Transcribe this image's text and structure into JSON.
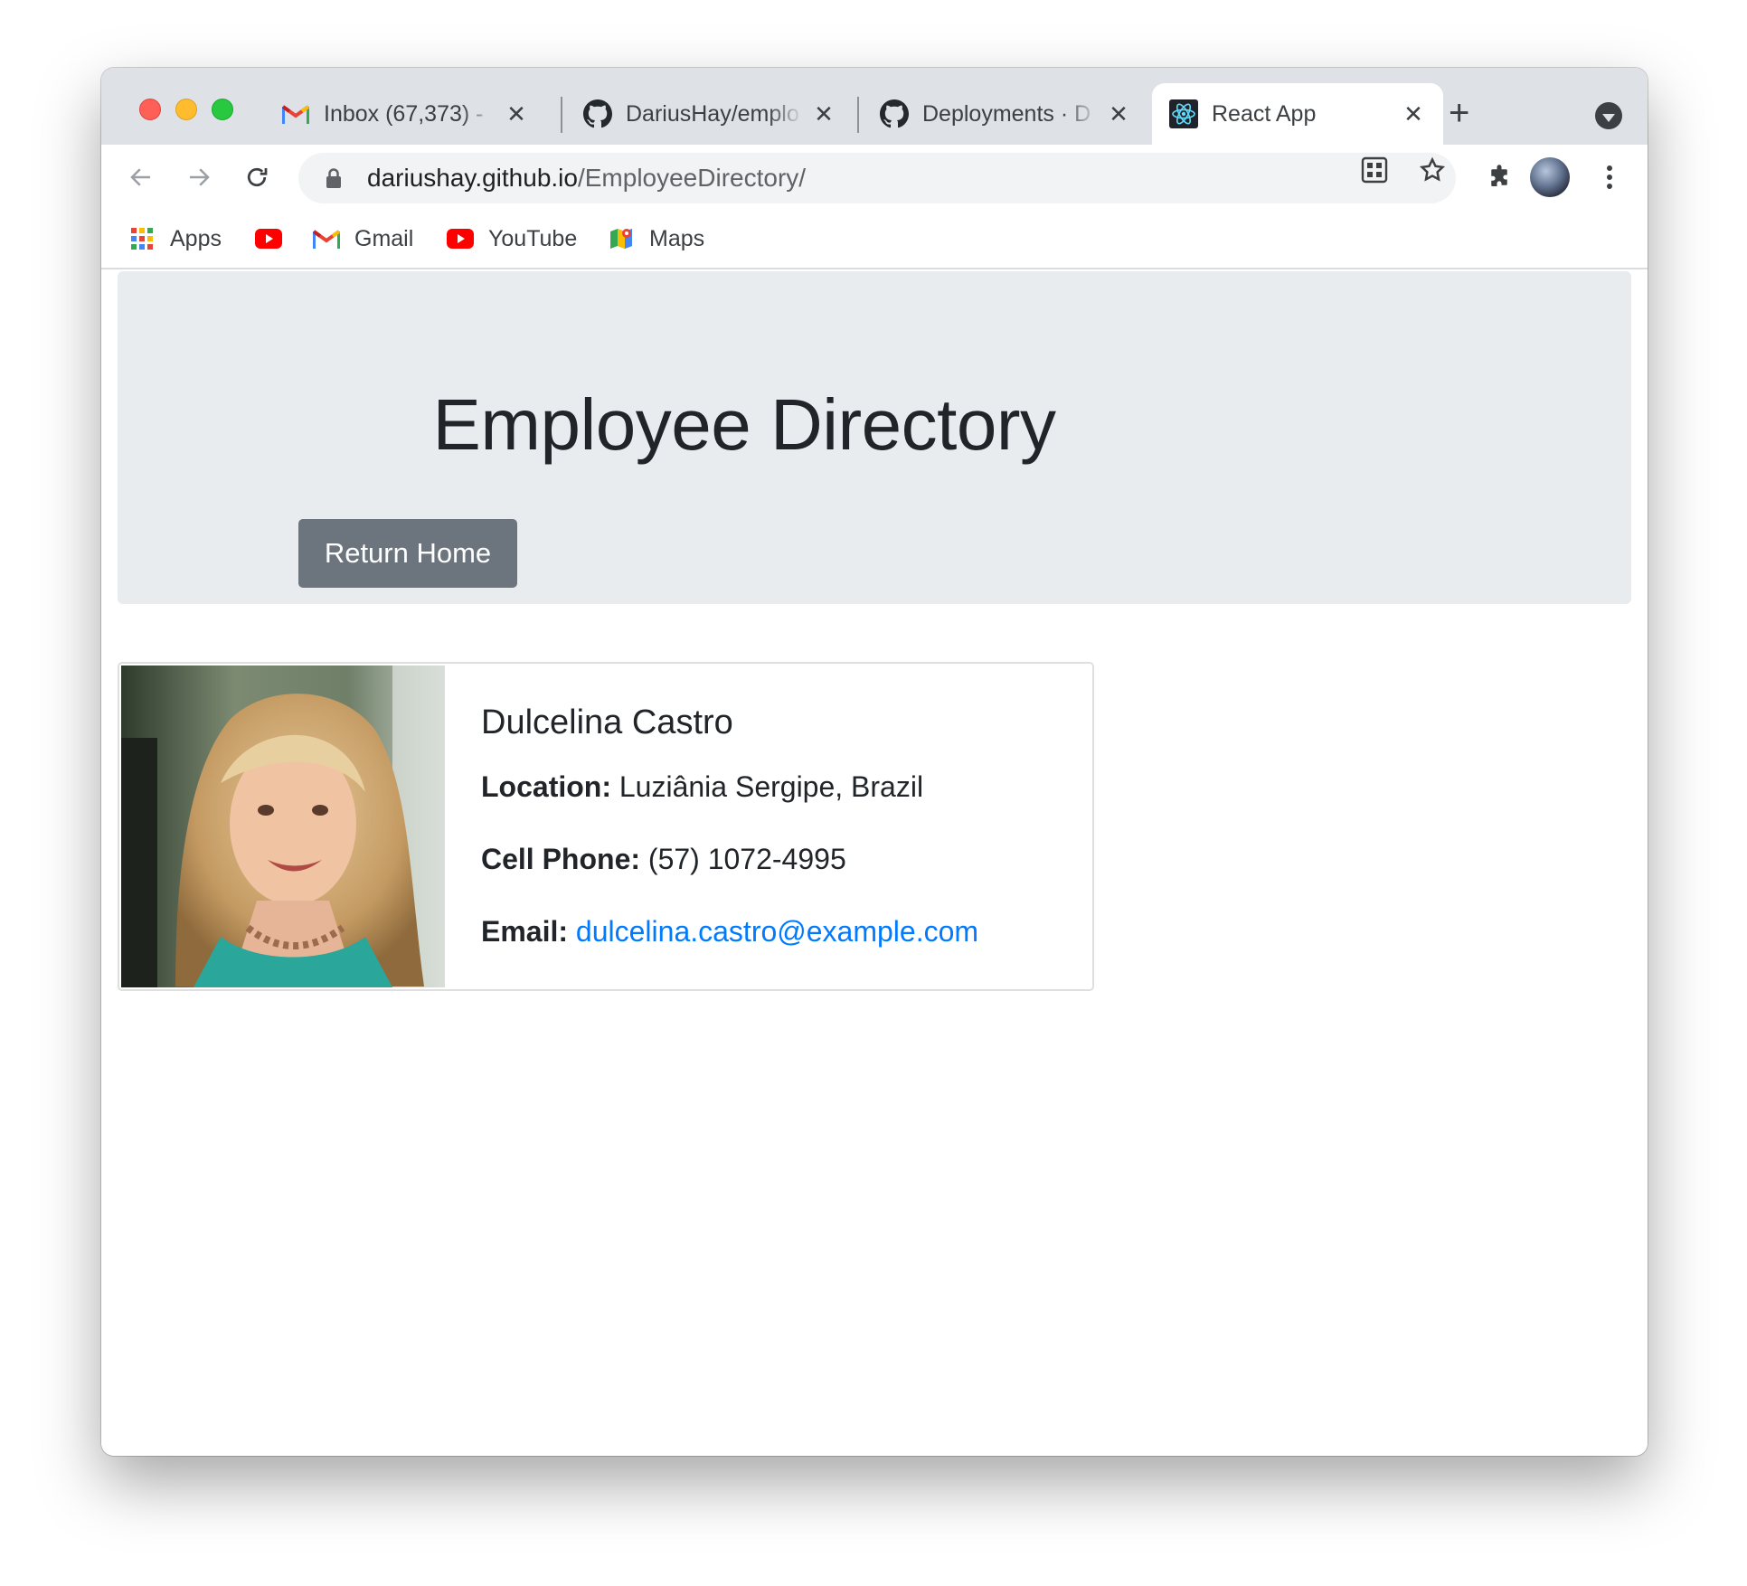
{
  "browser": {
    "tabs": [
      {
        "title": "Inbox (67,373) - ",
        "favicon": "gmail-icon"
      },
      {
        "title": "DariusHay/emplo",
        "favicon": "github-icon"
      },
      {
        "title": "Deployments · D",
        "favicon": "github-icon"
      },
      {
        "title": "React App",
        "favicon": "react-icon",
        "active": true
      }
    ],
    "address": {
      "host": "dariushay.github.io",
      "path": "/EmployeeDirectory/"
    },
    "bookmarks": [
      {
        "label": "Apps",
        "icon": "apps-grid-icon"
      },
      {
        "label": "",
        "icon": "youtube-icon"
      },
      {
        "label": "Gmail",
        "icon": "gmail-icon"
      },
      {
        "label": "YouTube",
        "icon": "youtube-icon"
      },
      {
        "label": "Maps",
        "icon": "maps-icon"
      }
    ]
  },
  "page": {
    "title": "Employee Directory",
    "return_button": "Return Home",
    "employee": {
      "name": "Dulcelina Castro",
      "location_label": "Location:",
      "location": "Luziânia Sergipe, Brazil",
      "phone_label": "Cell Phone:",
      "phone": "(57) 1072-4995",
      "email_label": "Email:",
      "email": "dulcelina.castro@example.com"
    }
  },
  "colors": {
    "jumbotron_bg": "#e9ecef",
    "button_bg": "#6c757d",
    "link": "#007bff"
  }
}
